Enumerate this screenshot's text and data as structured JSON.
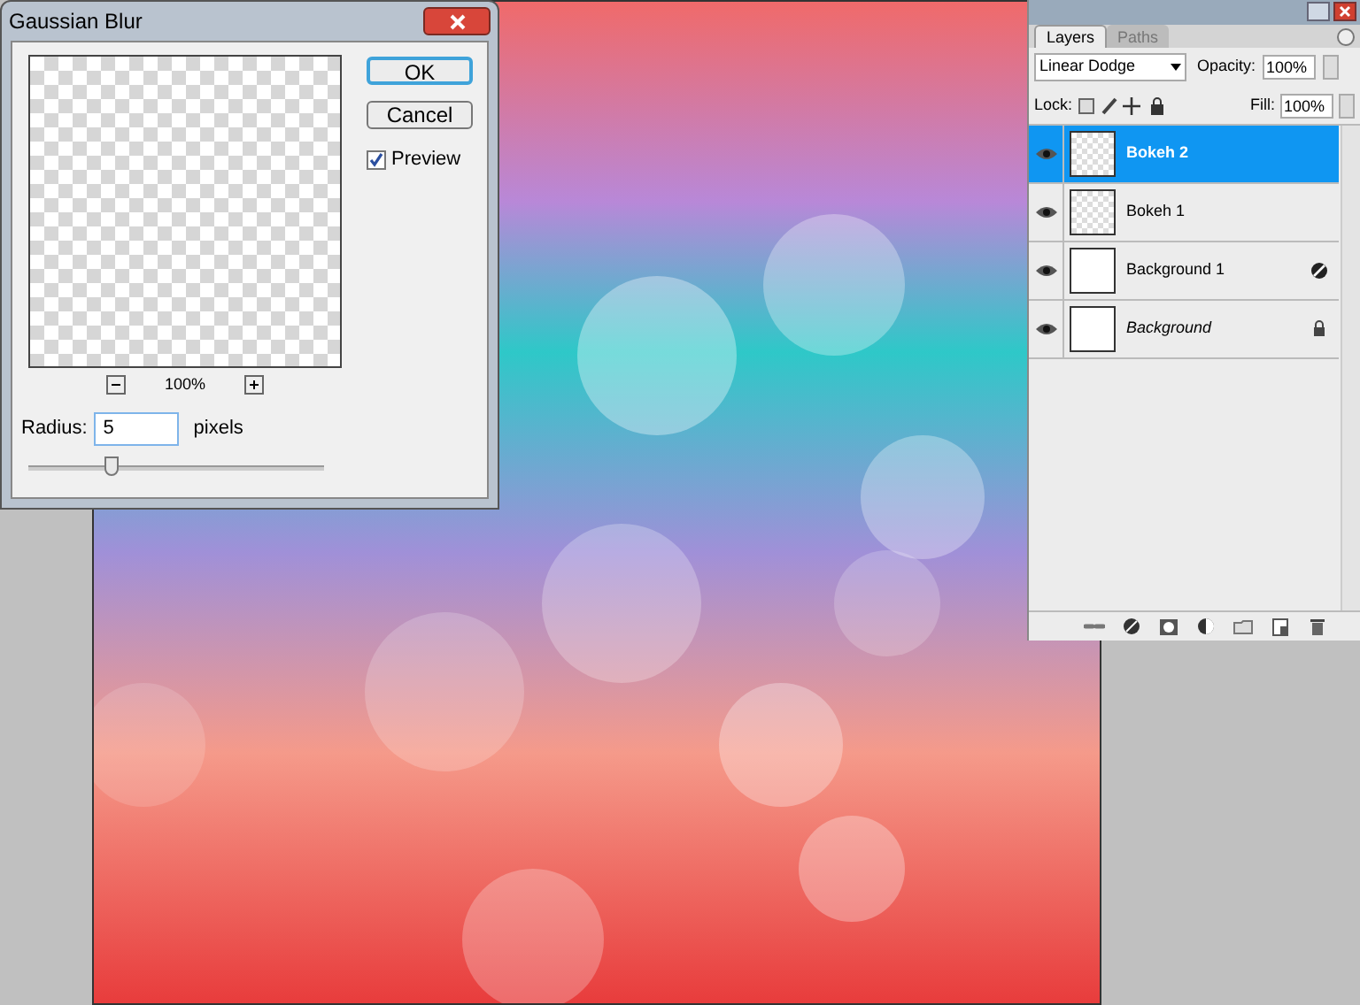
{
  "dialog": {
    "title": "Gaussian Blur",
    "zoom": "100%",
    "buttons": [
      {
        "label": "OK",
        "default": true
      },
      {
        "label": "Cancel",
        "default": false
      }
    ],
    "preview": {
      "label": "Preview",
      "checked": true
    },
    "radius": {
      "label": "Radius:",
      "value": "5",
      "unit": "pixels"
    },
    "slider": {
      "level": 0.28
    }
  },
  "layers_panel": {
    "tabs": [
      {
        "label": "Layers",
        "selected": true
      },
      {
        "label": "Paths",
        "selected": false
      }
    ],
    "blend_mode": "Linear Dodge",
    "opacity": {
      "label": "Opacity:",
      "value": "100%"
    },
    "lock_label": "Lock:",
    "fill": {
      "label": "Fill:",
      "value": "100%"
    },
    "layers": [
      {
        "name": "Bokeh 2",
        "kind": "pixel",
        "visible": true,
        "selected": true
      },
      {
        "name": "Bokeh 1",
        "kind": "pixel",
        "visible": true,
        "selected": false
      },
      {
        "name": "Background 1",
        "kind": "adjustment",
        "visible": true,
        "selected": false
      },
      {
        "name": "Background",
        "kind": "background",
        "visible": true,
        "selected": false
      }
    ]
  }
}
